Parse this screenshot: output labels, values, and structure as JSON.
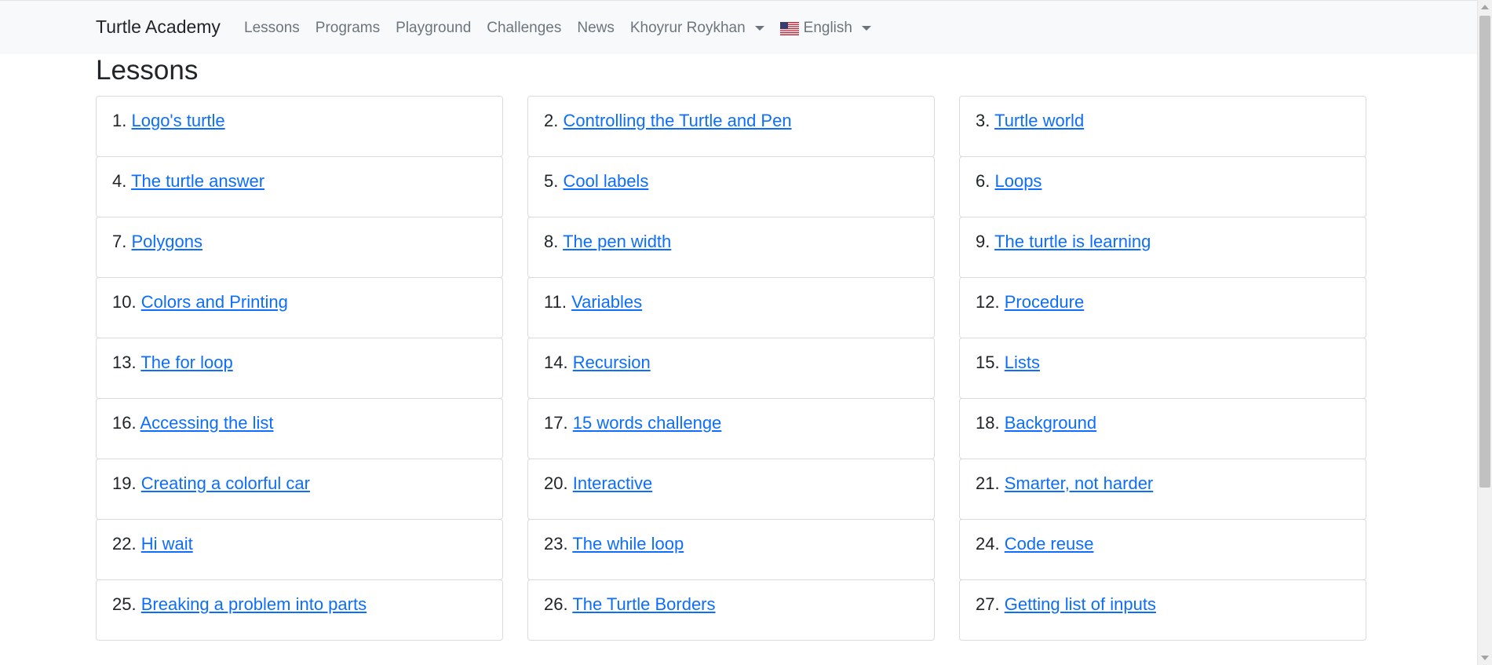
{
  "nav": {
    "brand": "Turtle Academy",
    "links": [
      "Lessons",
      "Programs",
      "Playground",
      "Challenges",
      "News"
    ],
    "user_label": "Khoyrur Roykhan",
    "language_label": "English",
    "language_flag_icon": "us-flag-icon"
  },
  "page_title": "Lessons",
  "colors": {
    "link": "#0d6efd",
    "navbar_bg": "#f8f9fa",
    "text": "#212529",
    "nav_text": "#6c757d"
  },
  "lessons": [
    {
      "num": "1.",
      "title": "Logo's turtle"
    },
    {
      "num": "2.",
      "title": "Controlling the Turtle and Pen"
    },
    {
      "num": "3.",
      "title": "Turtle world"
    },
    {
      "num": "4.",
      "title": "The turtle answer"
    },
    {
      "num": "5.",
      "title": "Cool labels"
    },
    {
      "num": "6.",
      "title": "Loops"
    },
    {
      "num": "7.",
      "title": "Polygons"
    },
    {
      "num": "8.",
      "title": "The pen width"
    },
    {
      "num": "9.",
      "title": "The turtle is learning"
    },
    {
      "num": "10.",
      "title": "Colors and Printing"
    },
    {
      "num": "11.",
      "title": "Variables"
    },
    {
      "num": "12.",
      "title": "Procedure"
    },
    {
      "num": "13.",
      "title": "The for loop"
    },
    {
      "num": "14.",
      "title": "Recursion"
    },
    {
      "num": "15.",
      "title": "Lists"
    },
    {
      "num": "16.",
      "title": "Accessing the list"
    },
    {
      "num": "17.",
      "title": "15 words challenge"
    },
    {
      "num": "18.",
      "title": "Background"
    },
    {
      "num": "19.",
      "title": "Creating a colorful car"
    },
    {
      "num": "20.",
      "title": "Interactive"
    },
    {
      "num": "21.",
      "title": "Smarter, not harder"
    },
    {
      "num": "22.",
      "title": "Hi wait"
    },
    {
      "num": "23.",
      "title": "The while loop"
    },
    {
      "num": "24.",
      "title": "Code reuse"
    },
    {
      "num": "25.",
      "title": "Breaking a problem into parts"
    },
    {
      "num": "26.",
      "title": "The Turtle Borders"
    },
    {
      "num": "27.",
      "title": "Getting list of inputs"
    }
  ]
}
